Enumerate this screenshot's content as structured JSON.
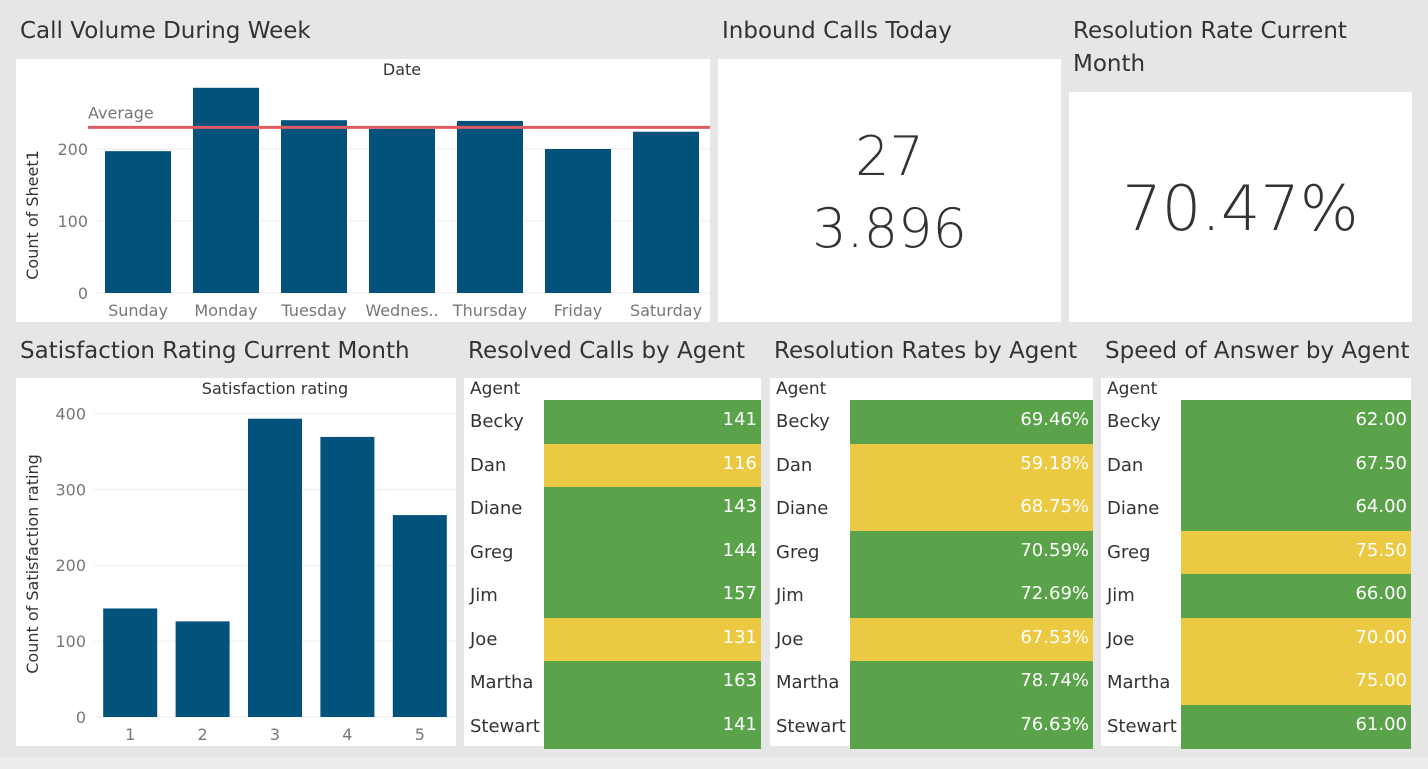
{
  "colors": {
    "bar": "#02527c",
    "average_line": "#e05b62",
    "green": "#5aa34b",
    "yellow": "#ebc943",
    "background": "#e6e6e6"
  },
  "titles": {
    "call_volume": "Call Volume During Week",
    "inbound_today": "Inbound Calls Today",
    "resolution_rate_line1": "Resolution Rate Current",
    "resolution_rate_line2": "Month",
    "satisfaction": "Satisfaction Rating Current Month",
    "resolved_by_agent": "Resolved Calls by Agent",
    "resolution_rates_by_agent": "Resolution Rates by Agent",
    "speed_by_agent": "Speed of Answer by Agent"
  },
  "kpis": {
    "inbound_calls": "27",
    "inbound_secondary": "3.896",
    "resolution_rate": "70.47%"
  },
  "chart_data": [
    {
      "type": "bar",
      "title": "Call Volume During Week",
      "header": "Date",
      "ylabel": "Count of Sheet1",
      "categories": [
        "Sunday",
        "Monday",
        "Tuesday",
        "Wednes..",
        "Thursday",
        "Friday",
        "Saturday"
      ],
      "values": [
        197,
        285,
        240,
        228,
        239,
        200,
        224
      ],
      "ylim": [
        0,
        300
      ],
      "yticks": [
        0,
        100,
        200
      ],
      "reference_line": {
        "label": "Average",
        "value": 230
      },
      "grid": true
    },
    {
      "type": "bar",
      "title": "Satisfaction Rating Current Month",
      "header": "Satisfaction rating",
      "ylabel": "Count of Satisfaction rating",
      "categories": [
        "1",
        "2",
        "3",
        "4",
        "5"
      ],
      "values": [
        143,
        126,
        393,
        369,
        266
      ],
      "ylim": [
        0,
        415
      ],
      "yticks": [
        0,
        100,
        200,
        300,
        400
      ],
      "grid": true
    },
    {
      "type": "table",
      "title": "Resolved Calls by Agent",
      "header": "Agent",
      "rows": [
        {
          "agent": "Becky",
          "value": "141",
          "status": "green"
        },
        {
          "agent": "Dan",
          "value": "116",
          "status": "yellow"
        },
        {
          "agent": "Diane",
          "value": "143",
          "status": "green"
        },
        {
          "agent": "Greg",
          "value": "144",
          "status": "green"
        },
        {
          "agent": "Jim",
          "value": "157",
          "status": "green"
        },
        {
          "agent": "Joe",
          "value": "131",
          "status": "yellow"
        },
        {
          "agent": "Martha",
          "value": "163",
          "status": "green"
        },
        {
          "agent": "Stewart",
          "value": "141",
          "status": "green"
        }
      ]
    },
    {
      "type": "table",
      "title": "Resolution Rates by Agent",
      "header": "Agent",
      "rows": [
        {
          "agent": "Becky",
          "value": "69.46%",
          "status": "green"
        },
        {
          "agent": "Dan",
          "value": "59.18%",
          "status": "yellow"
        },
        {
          "agent": "Diane",
          "value": "68.75%",
          "status": "yellow"
        },
        {
          "agent": "Greg",
          "value": "70.59%",
          "status": "green"
        },
        {
          "agent": "Jim",
          "value": "72.69%",
          "status": "green"
        },
        {
          "agent": "Joe",
          "value": "67.53%",
          "status": "yellow"
        },
        {
          "agent": "Martha",
          "value": "78.74%",
          "status": "green"
        },
        {
          "agent": "Stewart",
          "value": "76.63%",
          "status": "green"
        }
      ]
    },
    {
      "type": "table",
      "title": "Speed of Answer by Agent",
      "header": "Agent",
      "rows": [
        {
          "agent": "Becky",
          "value": "62.00",
          "status": "green"
        },
        {
          "agent": "Dan",
          "value": "67.50",
          "status": "green"
        },
        {
          "agent": "Diane",
          "value": "64.00",
          "status": "green"
        },
        {
          "agent": "Greg",
          "value": "75.50",
          "status": "yellow"
        },
        {
          "agent": "Jim",
          "value": "66.00",
          "status": "green"
        },
        {
          "agent": "Joe",
          "value": "70.00",
          "status": "yellow"
        },
        {
          "agent": "Martha",
          "value": "75.00",
          "status": "yellow"
        },
        {
          "agent": "Stewart",
          "value": "61.00",
          "status": "green"
        }
      ]
    }
  ]
}
